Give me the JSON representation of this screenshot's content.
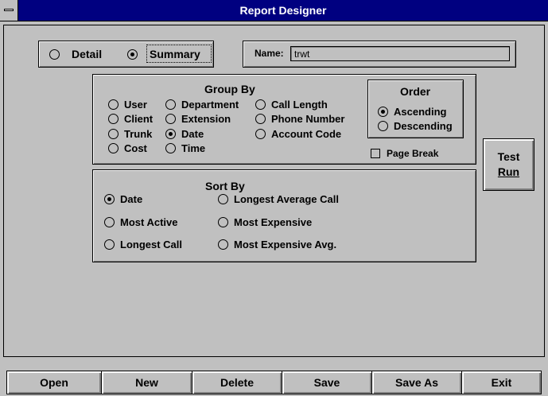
{
  "window": {
    "title": "Report Designer"
  },
  "mode": {
    "options": [
      {
        "label": "Detail",
        "selected": false
      },
      {
        "label": "Summary",
        "selected": true
      }
    ]
  },
  "name_field": {
    "label": "Name:",
    "value": "trwt"
  },
  "group_by": {
    "title": "Group By",
    "options": [
      {
        "label": "User",
        "selected": false
      },
      {
        "label": "Department",
        "selected": false
      },
      {
        "label": "Call Length",
        "selected": false
      },
      {
        "label": "Client",
        "selected": false
      },
      {
        "label": "Extension",
        "selected": false
      },
      {
        "label": "Phone Number",
        "selected": false
      },
      {
        "label": "Trunk",
        "selected": false
      },
      {
        "label": "Date",
        "selected": true
      },
      {
        "label": "Account Code",
        "selected": false
      },
      {
        "label": "Cost",
        "selected": false
      },
      {
        "label": "Time",
        "selected": false
      }
    ]
  },
  "order": {
    "title": "Order",
    "options": [
      {
        "label": "Ascending",
        "selected": true
      },
      {
        "label": "Descending",
        "selected": false
      }
    ]
  },
  "page_break": {
    "label": "Page Break",
    "checked": false
  },
  "test_run": {
    "line1": "Test",
    "line2": "Run"
  },
  "sort_by": {
    "title": "Sort By",
    "options": [
      {
        "label": "Date",
        "selected": true
      },
      {
        "label": "Longest Average Call",
        "selected": false
      },
      {
        "label": "Most Active",
        "selected": false
      },
      {
        "label": "Most Expensive",
        "selected": false
      },
      {
        "label": "Longest Call",
        "selected": false
      },
      {
        "label": "Most Expensive Avg.",
        "selected": false
      }
    ]
  },
  "bottom_buttons": [
    "Open",
    "New",
    "Delete",
    "Save",
    "Save As",
    "Exit"
  ]
}
